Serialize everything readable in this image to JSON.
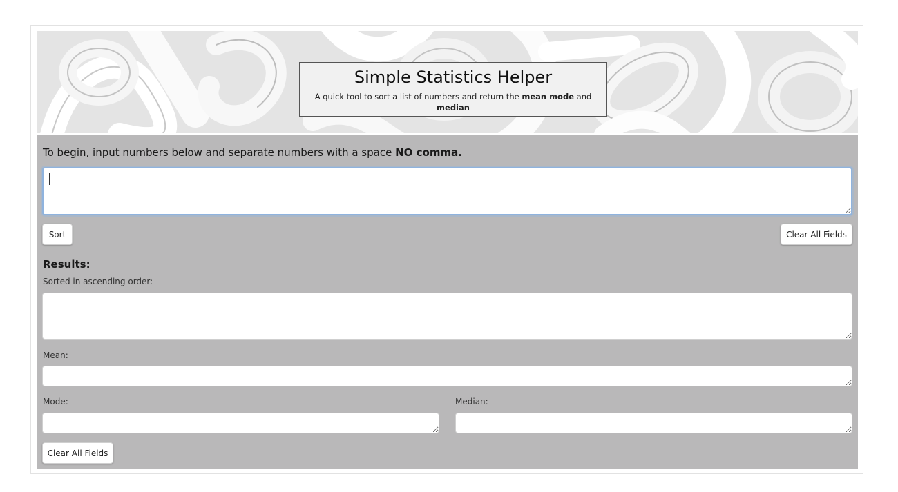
{
  "banner": {
    "title": "Simple Statistics Helper",
    "subtitle_pre": "A quick tool to sort a list of numbers and return the ",
    "subtitle_bold1": "mean mode",
    "subtitle_mid": " and ",
    "subtitle_bold2": "median"
  },
  "input_section": {
    "instruction_pre": "To begin, input numbers below and separate numbers with a space ",
    "instruction_bold": "NO comma.",
    "numbers_value": ""
  },
  "buttons": {
    "sort_label": "Sort",
    "clear_top_label": "Clear All Fields",
    "clear_bottom_label": "Clear All Fields"
  },
  "results": {
    "heading": "Results:",
    "sorted_label": "Sorted in ascending order:",
    "sorted_value": "",
    "mean_label": "Mean:",
    "mean_value": "",
    "mode_label": "Mode:",
    "mode_value": "",
    "median_label": "Median:",
    "median_value": ""
  },
  "colors": {
    "panel_bg": "#b9b8b9",
    "focus_border": "#8fb3de"
  }
}
